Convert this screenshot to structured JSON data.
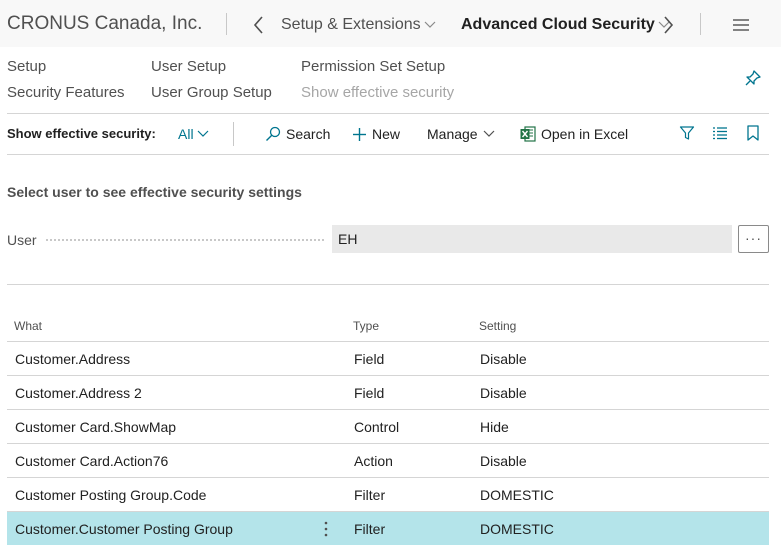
{
  "header": {
    "company": "CRONUS Canada, Inc.",
    "breadcrumb_parent": "Setup & Extensions",
    "breadcrumb_current": "Advanced Cloud Security"
  },
  "nav": {
    "setup": "Setup",
    "security_features": "Security Features",
    "user_setup": "User Setup",
    "user_group_setup": "User Group Setup",
    "permission_set_setup": "Permission Set Setup",
    "show_effective_security": "Show effective security"
  },
  "action_bar": {
    "filter_label": "Show effective security:",
    "filter_value": "All",
    "search": "Search",
    "new": "New",
    "manage": "Manage",
    "open_in_excel": "Open in Excel"
  },
  "form": {
    "section_title": "Select user to see effective security settings",
    "user_label": "User",
    "user_value": "EH",
    "lookup_label": "···"
  },
  "table": {
    "columns": {
      "what": "What",
      "type": "Type",
      "setting": "Setting"
    },
    "rows": [
      {
        "what": "Customer.Address",
        "type": "Field",
        "setting": "Disable",
        "selected": false
      },
      {
        "what": "Customer.Address 2",
        "type": "Field",
        "setting": "Disable",
        "selected": false
      },
      {
        "what": "Customer Card.ShowMap",
        "type": "Control",
        "setting": "Hide",
        "selected": false
      },
      {
        "what": "Customer Card.Action76",
        "type": "Action",
        "setting": "Disable",
        "selected": false
      },
      {
        "what": "Customer Posting Group.Code",
        "type": "Filter",
        "setting": "DOMESTIC",
        "selected": false
      },
      {
        "what": "Customer.Customer Posting Group",
        "type": "Filter",
        "setting": "DOMESTIC",
        "selected": true
      }
    ]
  },
  "colors": {
    "accent": "#00758f",
    "selected_row": "#b4e4ea",
    "excel_green": "#217346"
  }
}
